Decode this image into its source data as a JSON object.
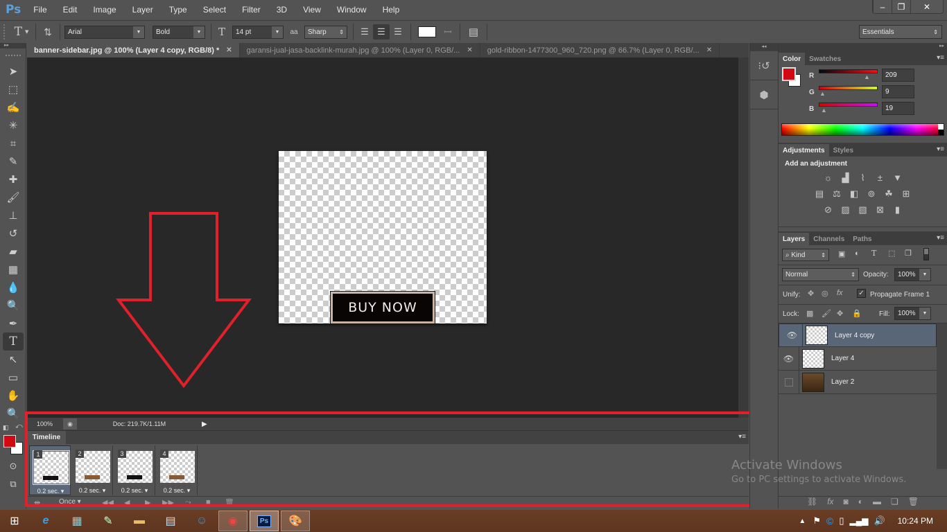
{
  "app": {
    "logo": "Ps"
  },
  "menu": [
    "File",
    "Edit",
    "Image",
    "Layer",
    "Type",
    "Select",
    "Filter",
    "3D",
    "View",
    "Window",
    "Help"
  ],
  "window_controls": {
    "minimize": "–",
    "restore": "❐",
    "close": "✕"
  },
  "options_bar": {
    "tool_icon": "T",
    "font_family": "Arial",
    "font_style": "Bold",
    "font_size": "14 pt",
    "antialias": "Sharp",
    "antialias_icon": "aa",
    "text_color": "#ffffff",
    "workspace": "Essentials"
  },
  "tabs": [
    {
      "label": "banner-sidebar.jpg @ 100% (Layer 4 copy, RGB/8) *",
      "active": true
    },
    {
      "label": "garansi-jual-jasa-backlink-murah.jpg @ 100% (Layer 0, RGB/...",
      "active": false
    },
    {
      "label": "gold-ribbon-1477300_960_720.png @ 66.7% (Layer 0, RGB/...",
      "active": false
    }
  ],
  "canvas": {
    "button_text": "BUY NOW"
  },
  "status": {
    "zoom": "100%",
    "doc": "Doc: 219.7K/1.11M"
  },
  "timeline": {
    "title": "Timeline",
    "frames": [
      {
        "num": "1",
        "delay": "0.2 sec.",
        "selected": true,
        "mini": "#111111"
      },
      {
        "num": "2",
        "delay": "0.2 sec.",
        "selected": false,
        "mini": "#8a5a35"
      },
      {
        "num": "3",
        "delay": "0.2 sec.",
        "selected": false,
        "mini": "#111111"
      },
      {
        "num": "4",
        "delay": "0.2 sec.",
        "selected": false,
        "mini": "#8a5a35"
      }
    ],
    "loop": "Once"
  },
  "colors": {
    "foreground": "#d10913",
    "background": "#ffffff",
    "annotation": "#e0202a"
  },
  "color_panel": {
    "tabs": [
      "Color",
      "Swatches"
    ],
    "r_label": "R",
    "g_label": "G",
    "b_label": "B",
    "r": "209",
    "g": "9",
    "b": "19"
  },
  "adjustments_panel": {
    "tabs": [
      "Adjustments",
      "Styles"
    ],
    "heading": "Add an adjustment"
  },
  "layers_panel": {
    "tabs": [
      "Layers",
      "Channels",
      "Paths"
    ],
    "filter": "Kind",
    "blend_mode": "Normal",
    "opacity_label": "Opacity:",
    "opacity": "100%",
    "unify_label": "Unify:",
    "propagate_label": "Propagate Frame 1",
    "propagate_checked": true,
    "lock_label": "Lock:",
    "fill_label": "Fill:",
    "fill": "100%",
    "layers": [
      {
        "name": "Layer 4 copy",
        "visible": true,
        "selected": true
      },
      {
        "name": "Layer 4",
        "visible": true,
        "selected": false
      },
      {
        "name": "Layer 2",
        "visible": false,
        "selected": false
      }
    ]
  },
  "watermark": {
    "title": "Activate Windows",
    "subtitle": "Go to PC settings to activate Windows."
  },
  "taskbar": {
    "clock": "10:24 PM"
  }
}
